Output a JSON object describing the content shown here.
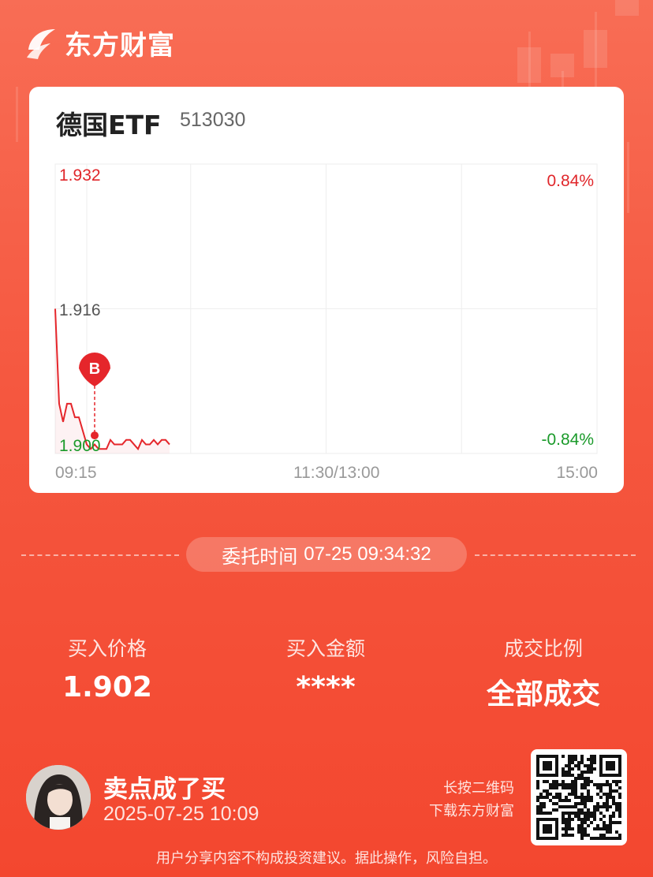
{
  "brand": {
    "name": "东方财富",
    "icon": "eastmoney-logo-icon"
  },
  "stock": {
    "name": "德国ETF",
    "code": "513030"
  },
  "chart_data": {
    "type": "line",
    "y_left": {
      "max": "1.932",
      "mid": "1.916",
      "min": "1.900"
    },
    "y_right": {
      "max": "0.84%",
      "min": "-0.84%"
    },
    "x_labels": [
      "09:15",
      "11:30/13:00",
      "15:00"
    ],
    "ylim": [
      1.9,
      1.932
    ],
    "series": [
      {
        "values": [
          1.916,
          1.9055,
          1.9035,
          1.9055,
          1.9055,
          1.904,
          1.904,
          1.9025,
          1.901,
          1.9005,
          1.901,
          1.9005,
          1.9005,
          1.9005,
          1.9015,
          1.901,
          1.901,
          1.901,
          1.9015,
          1.9015,
          1.901,
          1.9005,
          1.9015,
          1.901,
          1.901,
          1.9015,
          1.901,
          1.9015,
          1.9015,
          1.901
        ]
      }
    ],
    "buy_marker": {
      "label": "B",
      "price": 1.902,
      "index": 10
    }
  },
  "order": {
    "label": "委托时间",
    "time": "07-25 09:34:32"
  },
  "stats": [
    {
      "label": "买入价格",
      "value": "1.902"
    },
    {
      "label": "买入金额",
      "value": "****"
    },
    {
      "label": "成交比例",
      "value": "全部成交"
    }
  ],
  "user": {
    "name": "卖点成了买",
    "time": "2025-07-25 10:09"
  },
  "qr_hint": {
    "line1": "长按二维码",
    "line2": "下载东方财富"
  },
  "disclaimer": "用户分享内容不构成投资建议。据此操作，风险自担。",
  "colors": {
    "up": "#e0262a",
    "down": "#1a9a2a",
    "line": "#e5262b"
  }
}
